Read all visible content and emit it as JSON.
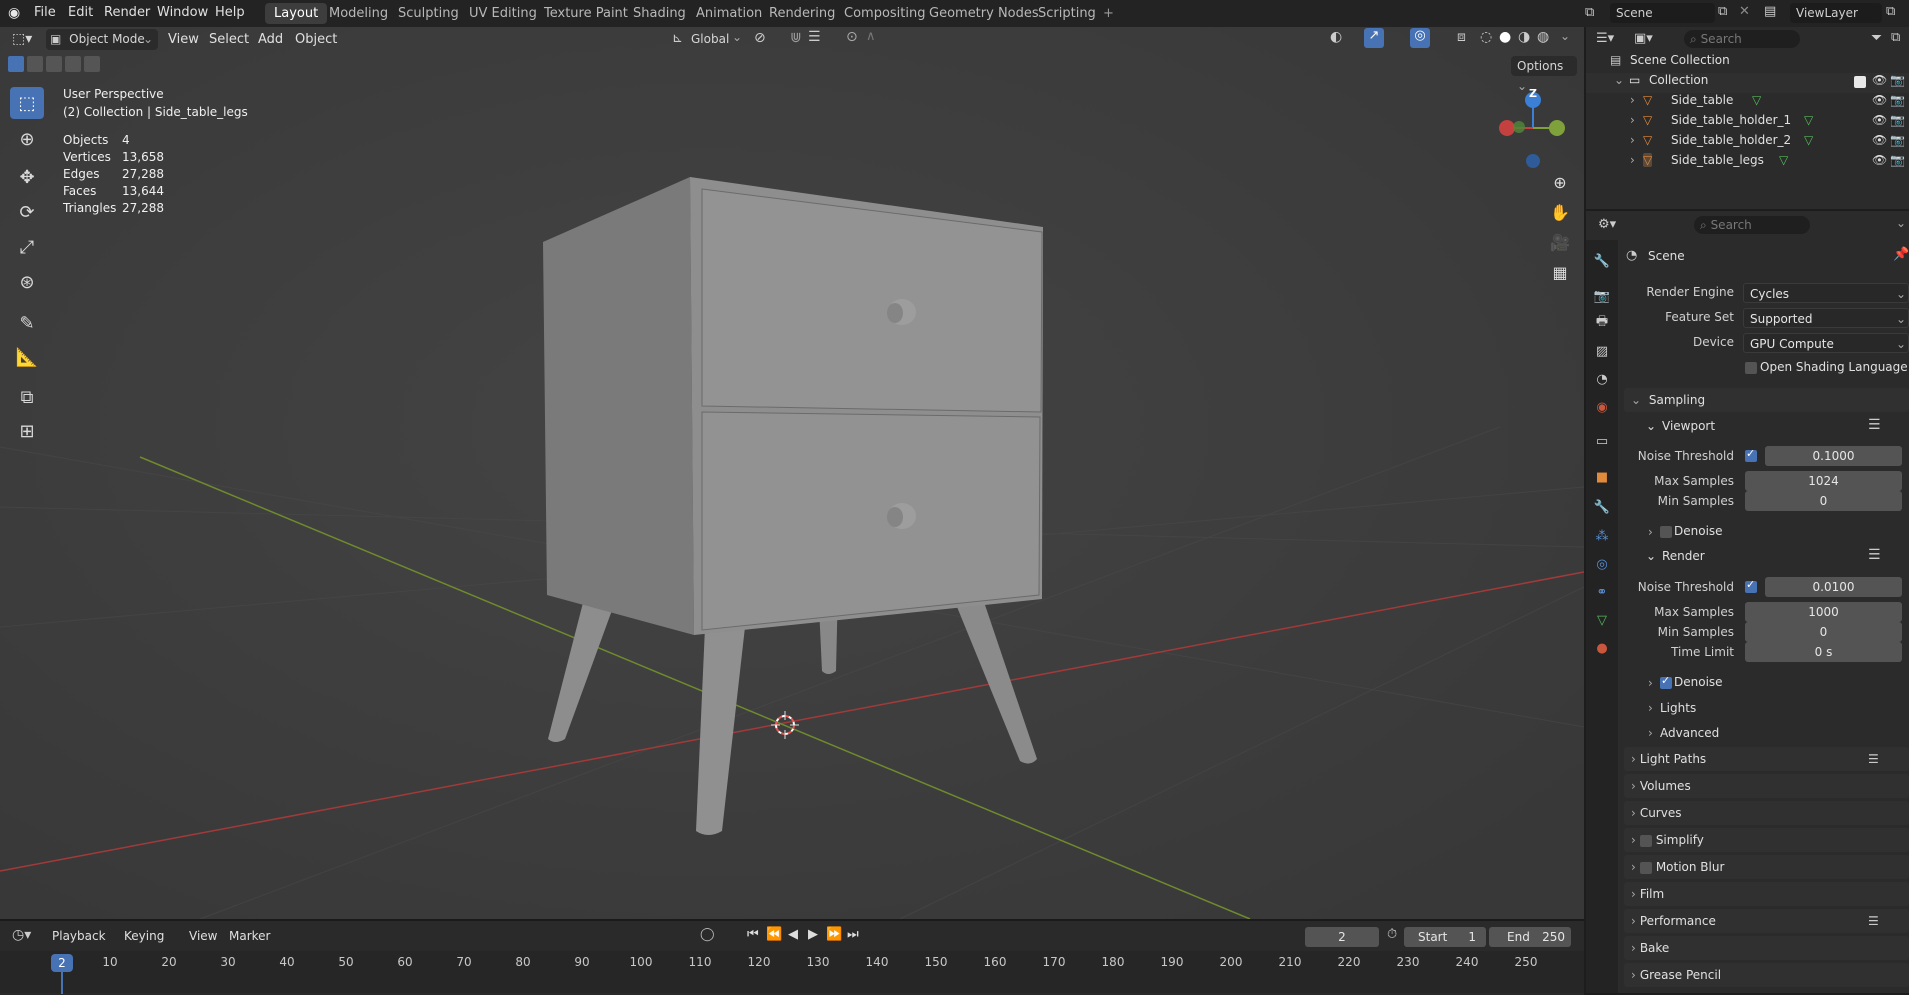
{
  "menu": {
    "items": [
      "File",
      "Edit",
      "Render",
      "Window",
      "Help"
    ],
    "workspace_tabs": [
      "Layout",
      "Modeling",
      "Sculpting",
      "UV Editing",
      "Texture Paint",
      "Shading",
      "Animation",
      "Rendering",
      "Compositing",
      "Geometry Nodes",
      "Scripting"
    ],
    "active_tab": "Layout",
    "add_tab": "+",
    "scene": "Scene",
    "view_layer": "ViewLayer"
  },
  "viewport_header": {
    "mode": "Object Mode",
    "menus": [
      "View",
      "Select",
      "Add",
      "Object"
    ],
    "transform_orientation": "Global",
    "options": "Options"
  },
  "viewport_overlay": {
    "perspective": "User Perspective",
    "collection_info": "(2) Collection | Side_table_legs",
    "stats": [
      {
        "label": "Objects",
        "value": "4"
      },
      {
        "label": "Vertices",
        "value": "13,658"
      },
      {
        "label": "Edges",
        "value": "27,288"
      },
      {
        "label": "Faces",
        "value": "13,644"
      },
      {
        "label": "Triangles",
        "value": "27,288"
      }
    ],
    "gizmo_axis_z": "Z"
  },
  "timeline": {
    "menus": [
      "Playback",
      "Keying",
      "View",
      "Marker"
    ],
    "current_frame": "2",
    "start_label": "Start",
    "start": "1",
    "end_label": "End",
    "end": "250",
    "ruler_marker": "2",
    "ruler": [
      "10",
      "20",
      "30",
      "40",
      "50",
      "60",
      "70",
      "80",
      "90",
      "100",
      "110",
      "120",
      "130",
      "140",
      "150",
      "160",
      "170",
      "180",
      "190",
      "200",
      "210",
      "220",
      "230",
      "240",
      "250"
    ]
  },
  "outliner": {
    "search_placeholder": "Search",
    "root": "Scene Collection",
    "collection": "Collection",
    "objects": [
      "Side_table",
      "Side_table_holder_1",
      "Side_table_holder_2",
      "Side_table_legs"
    ]
  },
  "properties": {
    "search_placeholder": "Search",
    "context": "Scene",
    "render_engine_label": "Render Engine",
    "render_engine": "Cycles",
    "feature_set_label": "Feature Set",
    "feature_set": "Supported",
    "device_label": "Device",
    "device": "GPU Compute",
    "osl_label": "Open Shading Language",
    "sampling": "Sampling",
    "viewport": "Viewport",
    "vp_noise_label": "Noise Threshold",
    "vp_noise": "0.1000",
    "vp_max_label": "Max Samples",
    "vp_max": "1024",
    "vp_min_label": "Min Samples",
    "vp_min": "0",
    "vp_denoise": "Denoise",
    "render": "Render",
    "r_noise_label": "Noise Threshold",
    "r_noise": "0.0100",
    "r_max_label": "Max Samples",
    "r_max": "1000",
    "r_min_label": "Min Samples",
    "r_min": "0",
    "r_time_label": "Time Limit",
    "r_time": "0 s",
    "r_denoise": "Denoise",
    "lights": "Lights",
    "advanced": "Advanced",
    "panels": [
      "Light Paths",
      "Volumes",
      "Curves",
      "Simplify",
      "Motion Blur",
      "Film",
      "Performance",
      "Bake",
      "Grease Pencil"
    ]
  },
  "colors": {
    "accent": "#4772b3",
    "x_axis": "#c4413f",
    "y_axis": "#7ea13b",
    "z_axis": "#3b7fd6",
    "viewport_bg": "#3d3d3d"
  }
}
